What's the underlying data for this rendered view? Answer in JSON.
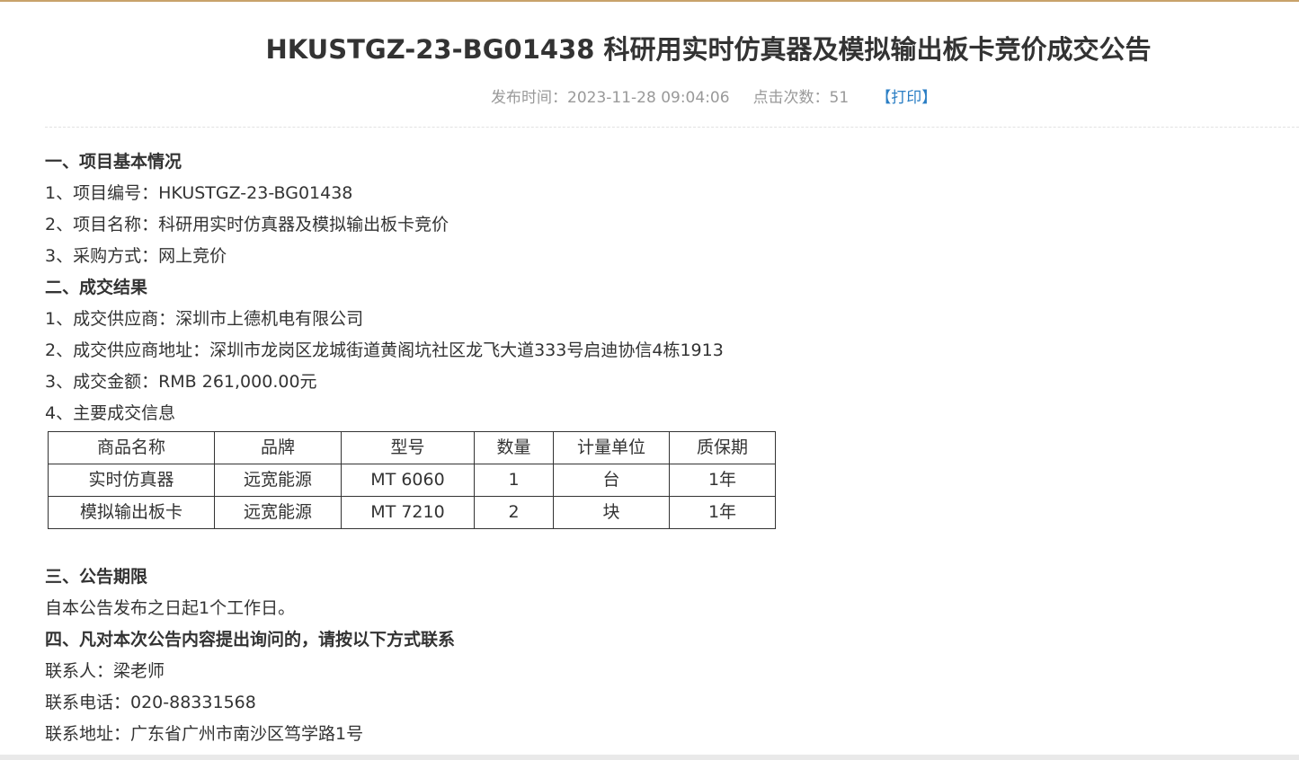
{
  "header": {
    "title": "HKUSTGZ-23-BG01438 科研用实时仿真器及模拟输出板卡竞价成交公告",
    "publish_time": "发布时间：2023-11-28 09:04:06",
    "click_count": "点击次数：51",
    "print_link": "【打印】"
  },
  "section1": {
    "heading": "一、项目基本情况",
    "items": [
      "1、项目编号：HKUSTGZ-23-BG01438",
      "2、项目名称：科研用实时仿真器及模拟输出板卡竞价",
      "3、采购方式：网上竞价"
    ]
  },
  "section2": {
    "heading": "二、成交结果",
    "items": [
      "1、成交供应商：深圳市上德机电有限公司",
      "2、成交供应商地址：深圳市龙岗区龙城街道黄阁坑社区龙飞大道333号启迪协信4栋1913",
      "3、成交金额：RMB 261,000.00元",
      "4、主要成交信息"
    ],
    "table": {
      "headers": [
        "商品名称",
        "品牌",
        "型号",
        "数量",
        "计量单位",
        "质保期"
      ],
      "rows": [
        [
          "实时仿真器",
          "远宽能源",
          "MT 6060",
          "1",
          "台",
          "1年"
        ],
        [
          "模拟输出板卡",
          "远宽能源",
          "MT 7210",
          "2",
          "块",
          "1年"
        ]
      ]
    }
  },
  "section3": {
    "heading": "三、公告期限",
    "text": "自本公告发布之日起1个工作日。"
  },
  "section4": {
    "heading": "四、凡对本次公告内容提出询问的，请按以下方式联系",
    "items": [
      "联系人：梁老师",
      "联系电话：020-88331568",
      "联系地址：广东省广州市南沙区笃学路1号"
    ]
  }
}
